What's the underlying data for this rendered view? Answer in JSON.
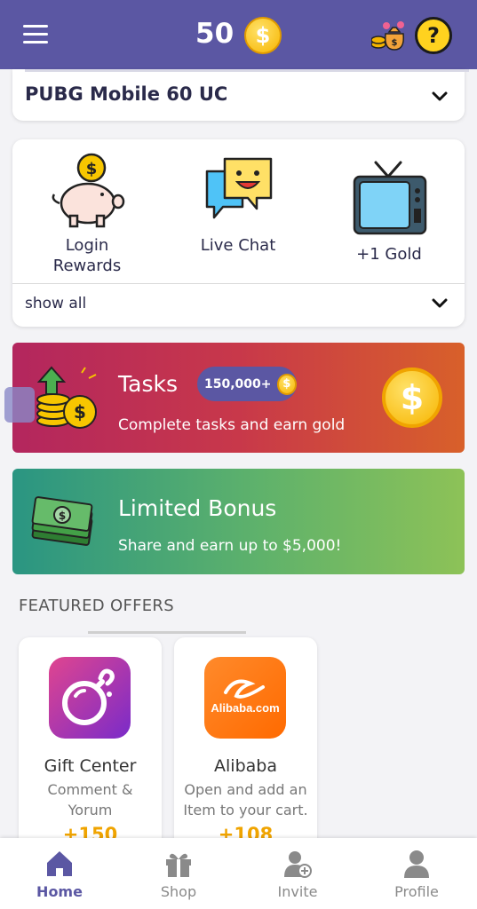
{
  "header": {
    "coin_balance": "50",
    "coin_symbol": "$",
    "help_symbol": "?",
    "icons": [
      "menu-icon",
      "coin-icon",
      "moneybag-icon",
      "help-icon"
    ]
  },
  "game_select": {
    "selected": "PUBG Mobile 60 UC"
  },
  "features": {
    "items": [
      {
        "label_line1": "Login",
        "label_line2": "Rewards",
        "icon": "piggy-bank-icon"
      },
      {
        "label_line1": "Live Chat",
        "label_line2": "",
        "icon": "chat-bubbles-icon"
      },
      {
        "label_line1": "+1 Gold",
        "label_line2": "",
        "icon": "tv-icon"
      }
    ],
    "show_all": "show all"
  },
  "tasks_banner": {
    "title": "Tasks",
    "badge": "150,000+",
    "subtitle": "Complete tasks and earn gold",
    "coin_symbol": "$"
  },
  "bonus_banner": {
    "title": "Limited Bonus",
    "subtitle": "Share and earn up to $5,000!"
  },
  "featured": {
    "title": "FEATURED OFFERS",
    "offers": [
      {
        "name": "Gift Center",
        "desc_line1": "Comment &",
        "desc_line2": "Yorum",
        "reward": "+150",
        "logo": "bomb-logo-icon"
      },
      {
        "name": "Alibaba",
        "desc_line1": "Open and add an",
        "desc_line2": "Item to your cart.",
        "reward": "+108",
        "logo_text": "Alibaba.com"
      }
    ]
  },
  "bottom_nav": {
    "items": [
      {
        "label": "Home",
        "icon": "home-icon",
        "active": true
      },
      {
        "label": "Shop",
        "icon": "gift-icon",
        "active": false
      },
      {
        "label": "Invite",
        "icon": "add-user-icon",
        "active": false
      },
      {
        "label": "Profile",
        "icon": "person-icon",
        "active": false
      }
    ]
  },
  "colors": {
    "primary": "#5b57a3",
    "gold": "#f7b500",
    "tasks_gradient_start": "#b3265e",
    "tasks_gradient_end": "#d8602a",
    "bonus_gradient_start": "#2a9582",
    "bonus_gradient_end": "#8dc257"
  }
}
